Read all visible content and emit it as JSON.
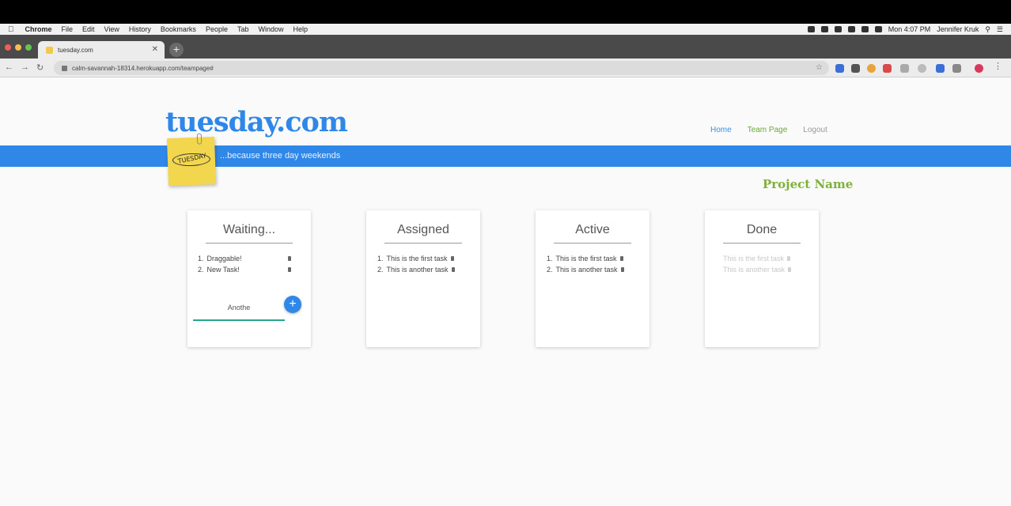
{
  "menubar": {
    "app": "Chrome",
    "items": [
      "File",
      "Edit",
      "View",
      "History",
      "Bookmarks",
      "People",
      "Tab",
      "Window",
      "Help"
    ],
    "clock": "Mon 4:07 PM",
    "user": "Jennifer Kruk"
  },
  "browser": {
    "tab_title": "tuesday.com",
    "url": "calm-savannah-18314.herokuapp.com/teampage#"
  },
  "site": {
    "logo": "tuesday.com",
    "tagline": "...because three day weekends",
    "sticky_text": "TUESDAY",
    "nav": [
      "Home",
      "Team Page",
      "Logout"
    ],
    "project_name": "Project Name"
  },
  "columns": [
    {
      "title": "Waiting...",
      "tasks": [
        "Draggable!",
        "New Task!"
      ],
      "new_task_value": "Anothe"
    },
    {
      "title": "Assigned",
      "tasks": [
        "This is the first task",
        "This is another task"
      ]
    },
    {
      "title": "Active",
      "tasks": [
        "This is the first task",
        "This is another task"
      ]
    },
    {
      "title": "Done",
      "tasks": [
        "This is the first task",
        "This is another task"
      ]
    }
  ],
  "colors": {
    "brand_blue": "#2f87e8",
    "green": "#7fb138",
    "input_underline": "#2aa58a"
  },
  "icons": [
    "apple-icon",
    "trash-icon",
    "plus-icon",
    "star-icon",
    "lock-icon",
    "close-icon"
  ]
}
